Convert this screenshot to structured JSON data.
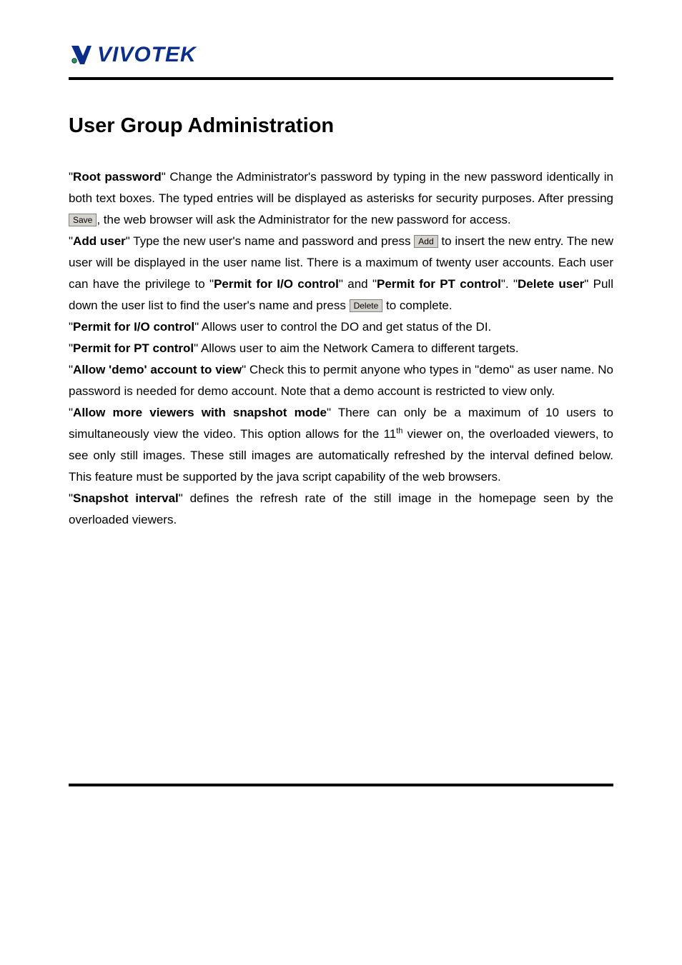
{
  "logo": {
    "brand_text": "VIVOTEK"
  },
  "title": "User Group Administration",
  "buttons": {
    "save": "Save",
    "add": "Add",
    "delete": "Delete"
  },
  "terms": {
    "root_password": "Root password",
    "add_user": "Add user",
    "delete_user": "Delete user",
    "permit_io": "Permit for I/O control",
    "permit_pt": "Permit for PT control",
    "allow_demo": "Allow 'demo' account to view",
    "allow_more_viewers": "Allow more viewers with snapshot mode",
    "snapshot_interval": "Snapshot interval"
  },
  "text": {
    "root_password_1": "\" Change the Administrator's password by typing in the new password identically in both text boxes. The typed entries will be displayed as asterisks for security purposes. After pressing ",
    "root_password_2": ", the web browser will ask the Administrator for the new password for access.",
    "add_user_1": "\" Type the new user's name and password and press ",
    "add_user_2": " to insert the new entry. The new user will be displayed in the user name list. There is a maximum of twenty user accounts. Each user can have the privilege to \"",
    "add_user_3": "\" and \"",
    "add_user_4": "\". \"",
    "delete_user_1": "\" Pull down the user list to find the user's name and press ",
    "delete_user_2": " to complete.",
    "permit_io_desc": "\" Allows user to control the DO and get status of the DI.",
    "permit_pt_desc": "\" Allows user to aim the Network Camera to different targets.",
    "allow_demo_desc": "\" Check this to permit anyone who types in \"demo\" as user name. No password is needed for demo account. Note that a demo account is restricted to view only.",
    "allow_more_1": "\" There can only be a maximum of 10 users to simultaneously view the video.   This option allows for the 11",
    "allow_more_sup": "th",
    "allow_more_2": " viewer on, the overloaded viewers, to see only still images.  These still images are automatically refreshed by the interval defined below. This feature must be supported by the java script capability of the web browsers.",
    "snapshot_desc": "\" defines the refresh rate of the still image in the homepage seen by the overloaded viewers."
  }
}
